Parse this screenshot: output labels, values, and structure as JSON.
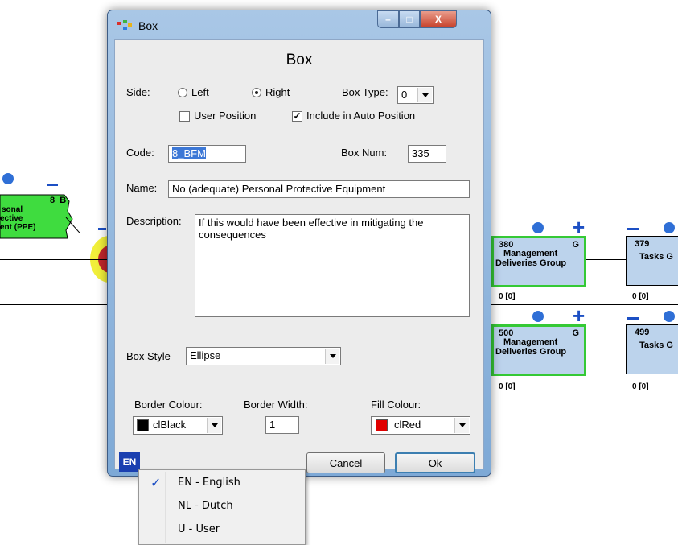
{
  "window": {
    "title": "Box",
    "minimize_glyph": "–",
    "maximize_glyph": "□",
    "close_glyph": "X"
  },
  "form": {
    "heading": "Box",
    "side_label": "Side:",
    "side_left": "Left",
    "side_right": "Right",
    "side_selected": "Right",
    "box_type_label": "Box Type:",
    "box_type_value": "0",
    "user_position_label": "User Position",
    "user_position_checked": false,
    "include_auto_label": "Include in Auto Position",
    "include_auto_checked": true,
    "code_label": "Code:",
    "code_value": "8_BFM",
    "box_num_label": "Box Num:",
    "box_num_value": "335",
    "name_label": "Name:",
    "name_value": "No (adequate) Personal Protective Equipment",
    "description_label": "Description:",
    "description_value": "If this would have been effective in mitigating the consequences",
    "box_style_label": "Box Style",
    "box_style_value": "Ellipse",
    "border_colour_label": "Border Colour:",
    "border_colour_value": "clBlack",
    "border_width_label": "Border Width:",
    "border_width_value": "1",
    "fill_colour_label": "Fill Colour:",
    "fill_colour_value": "clRed",
    "lang_button": "EN",
    "cancel_label": "Cancel",
    "ok_label": "Ok"
  },
  "menu": {
    "items": [
      {
        "label": "EN - English",
        "checked": true
      },
      {
        "label": "NL - Dutch",
        "checked": false
      },
      {
        "label": "U - User",
        "checked": false
      }
    ],
    "check_glyph": "✓"
  },
  "diagram": {
    "left_node": {
      "code": "8_B",
      "lines": [
        "sonal",
        "ective",
        "ent (PPE)"
      ]
    },
    "boxes": [
      {
        "num": "380",
        "flag": "G",
        "line1": "Management",
        "line2": "Deliveries Group",
        "count": "0 [0]"
      },
      {
        "num": "379",
        "line1": "Tasks G",
        "count": "0 [0]"
      },
      {
        "num": "500",
        "flag": "G",
        "line1": "Management",
        "line2": "Deliveries Group",
        "count": "0 [0]"
      },
      {
        "num": "499",
        "line1": "Tasks G",
        "count": "0 [0]"
      }
    ]
  },
  "colors": {
    "border_swatch": "#000000",
    "fill_swatch": "#e00000",
    "lang_button_bg": "#1a3fb0",
    "accent_blue": "#2f6fd6",
    "green_border": "#35c935"
  }
}
